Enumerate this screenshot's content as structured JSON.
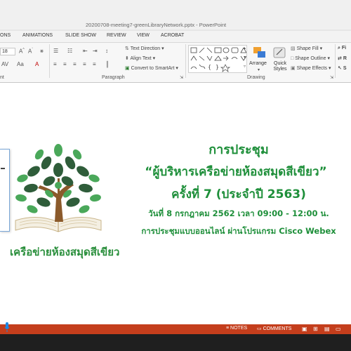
{
  "window": {
    "doc_title": "20200708-meeting7-greenLibraryNetwork.pptx - PowerPoint"
  },
  "tabs": [
    "ONS",
    "ANIMATIONS",
    "SLIDE SHOW",
    "REVIEW",
    "VIEW",
    "ACROBAT"
  ],
  "ribbon": {
    "font_size": "18",
    "paragraph": {
      "text_direction": "Text Direction",
      "align_text": "Align Text",
      "convert_smartart": "Convert to SmartArt",
      "group_label": "Paragraph"
    },
    "drawing": {
      "arrange": "Arrange",
      "quick_styles": "Quick Styles",
      "shape_fill": "Shape Fill",
      "shape_outline": "Shape Outline",
      "shape_effects": "Shape Effects",
      "group_label": "Drawing"
    },
    "edge_labels": [
      "Fi",
      "R",
      "S"
    ],
    "left_label": "nt"
  },
  "slide": {
    "line1": "การประชุม",
    "line2": "“ผู้บริหารเครือข่ายห้องสมุดสีเขียว”",
    "line3": "ครั้งที่ 7 (ประจำปี 2563)",
    "line4": "วันที่ 8 กรกฎาคม 2562  เวลา 09:00 - 12:00 น.",
    "line5": "การประชุมแบบออนไลน์ ผ่านโปรแกรม Cisco Webex",
    "logo_caption": "เครือข่ายห้องสมุดสีเขียว"
  },
  "status": {
    "notes": "NOTES",
    "comments": "COMMENTS"
  },
  "colors": {
    "accent": "#c43e1c",
    "slide_green": "#1e8f3a",
    "leaf_dark": "#2f5d3a",
    "leaf_light": "#4aa85a",
    "trunk": "#8b5a2b"
  }
}
